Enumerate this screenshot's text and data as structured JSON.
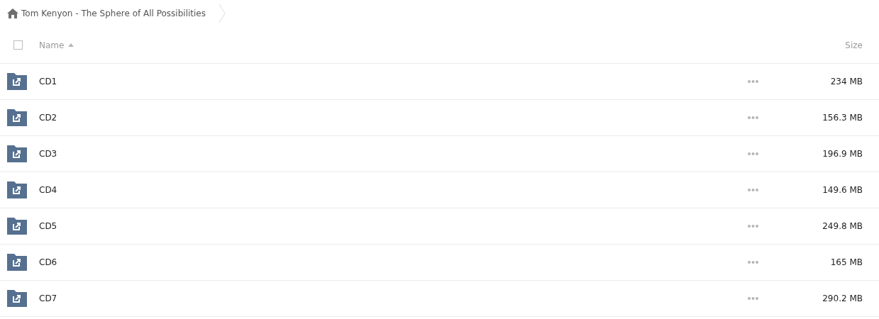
{
  "breadcrumb": {
    "title": "Tom Kenyon - The Sphere of All Possibilities"
  },
  "table": {
    "select_all": {
      "checked": false
    },
    "columns": [
      {
        "label": "Name",
        "sorted": true
      },
      {
        "label": "Size",
        "sorted": false
      }
    ],
    "rows": [
      {
        "name": "CD1",
        "size": "234 MB"
      },
      {
        "name": "CD2",
        "size": "156.3 MB"
      },
      {
        "name": "CD3",
        "size": "196.9 MB"
      },
      {
        "name": "CD4",
        "size": "149.6 MB"
      },
      {
        "name": "CD5",
        "size": "249.8 MB"
      },
      {
        "name": "CD6",
        "size": "165 MB"
      },
      {
        "name": "CD7",
        "size": "290.2 MB"
      }
    ]
  }
}
